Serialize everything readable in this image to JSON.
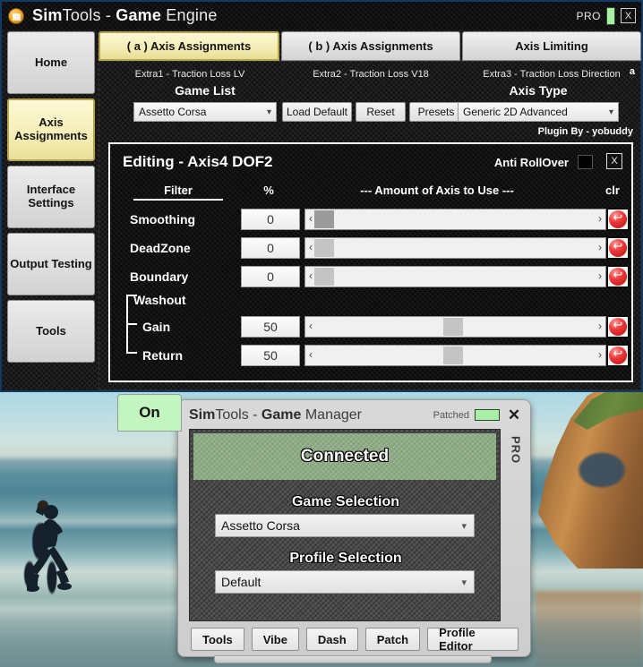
{
  "engine_window": {
    "title_bold1": "Sim",
    "title_normal1": "Tools - ",
    "title_bold2": "Game",
    "title_normal2": " Engine",
    "pro_label": "PRO",
    "close_label": "X",
    "app_icon": "simtools-logo-icon"
  },
  "sidebar": {
    "items": [
      {
        "label": "Home",
        "active": false
      },
      {
        "label": "Axis Assignments",
        "active": true
      },
      {
        "label": "Interface Settings",
        "active": false
      },
      {
        "label": "Output Testing",
        "active": false
      },
      {
        "label": "Tools",
        "active": false
      }
    ]
  },
  "tabs": [
    {
      "label": "( a ) Axis Assignments",
      "active": true
    },
    {
      "label": "( b ) Axis Assignments",
      "active": false
    },
    {
      "label": "Axis Limiting",
      "active": false
    }
  ],
  "extras": {
    "extra1": "Extra1 - Traction Loss LV",
    "extra2": "Extra2 - Traction Loss V18",
    "extra3": "Extra3 - Traction Loss Direction",
    "letter": "a"
  },
  "toolbar": {
    "game_list_heading": "Game List",
    "game_list_value": "Assetto Corsa",
    "load_default_label": "Load Default",
    "reset_label": "Reset",
    "presets_label": "Presets",
    "axis_type_heading": "Axis Type",
    "axis_type_value": "Generic 2D Advanced",
    "plugin_by": "Plugin By - yobuddy"
  },
  "editing_panel": {
    "title": "Editing - Axis4 DOF2",
    "anti_rollover_label": "Anti RollOver",
    "close_label": "X",
    "headers": {
      "filter": "Filter",
      "percent": "%",
      "amount": "---  Amount of Axis to Use  ---",
      "clr": "clr"
    },
    "washout_label": "Washout",
    "rows": [
      {
        "name": "Smoothing",
        "value": "0",
        "slider_pct": 3,
        "focused": true,
        "arrow_left": "‹",
        "arrow_right": "›"
      },
      {
        "name": "DeadZone",
        "value": "0",
        "slider_pct": 3,
        "focused": false,
        "arrow_left": "‹",
        "arrow_right": "›"
      },
      {
        "name": "Boundary",
        "value": "0",
        "slider_pct": 3,
        "focused": false,
        "arrow_left": "‹",
        "arrow_right": "›"
      },
      {
        "name": "Gain",
        "value": "50",
        "slider_pct": 46,
        "focused": false,
        "arrow_left": "‹",
        "arrow_right": "›"
      },
      {
        "name": "Return",
        "value": "50",
        "slider_pct": 46,
        "focused": false,
        "arrow_left": "‹",
        "arrow_right": "›"
      }
    ]
  },
  "game_manager": {
    "on_button_label": "On",
    "title_bold1": "Sim",
    "title_normal1": "Tools - ",
    "title_bold2": "Game",
    "title_normal2": " Manager",
    "patched_label": "Patched",
    "close_label": "✕",
    "pro_label": "PRO",
    "status": "Connected",
    "game_selection_heading": "Game Selection",
    "game_selection_value": "Assetto Corsa",
    "profile_selection_heading": "Profile Selection",
    "profile_selection_value": "Default",
    "buttons": [
      {
        "label": "Tools",
        "wide": false
      },
      {
        "label": "Vibe",
        "wide": false
      },
      {
        "label": "Dash",
        "wide": false
      },
      {
        "label": "Patch",
        "wide": false
      },
      {
        "label": "Profile Editor",
        "wide": true
      }
    ]
  },
  "colors": {
    "accent_yellow": "#f5edb4",
    "status_green": "#8fae86",
    "lamp_green": "#a8f0a6",
    "clr_red": "#ef3b3b",
    "window_border_blue": "#0f3a63"
  }
}
